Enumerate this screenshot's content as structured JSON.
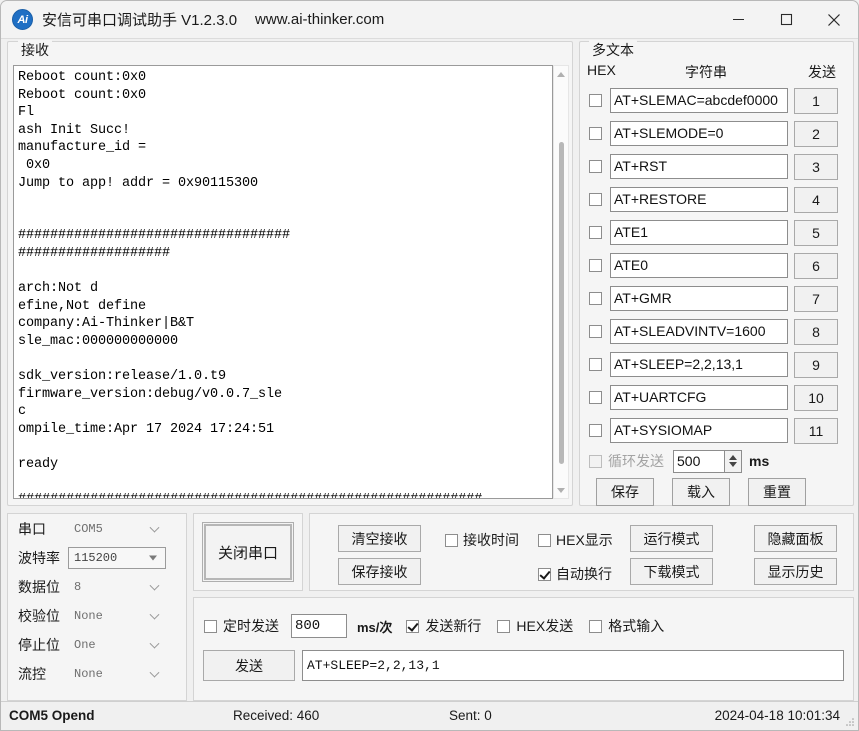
{
  "window": {
    "logo_text": "Ai",
    "title": "安信可串口调试助手 V1.2.3.0",
    "url": "www.ai-thinker.com",
    "minimize_icon": "minimize-icon",
    "maximize_icon": "maximize-icon",
    "close_icon": "close-icon"
  },
  "receive": {
    "legend": "接收",
    "content": "Reboot count:0x0\nReboot count:0x0\nFl\nash Init Succ!\nmanufacture_id =\n 0x0\nJump to app! addr = 0x90115300\n\n\n##################################\n###################\n\narch:Not d\nefine,Not define\ncompany:Ai-Thinker|B&T\nsle_mac:000000000000\n\nsdk_version:release/1.0.t9\nfirmware_version:debug/v0.0.7_sle\nc\nompile_time:Apr 17 2024 17:24:51\n\nready\n\n##########################################################"
  },
  "multitext": {
    "legend": "多文本",
    "col_hex": "HEX",
    "col_string": "字符串",
    "col_send": "发送",
    "rows": [
      {
        "hex_checked": false,
        "command": "AT+SLEMAC=abcdef0000",
        "index": "1"
      },
      {
        "hex_checked": false,
        "command": "AT+SLEMODE=0",
        "index": "2"
      },
      {
        "hex_checked": false,
        "command": "AT+RST",
        "index": "3"
      },
      {
        "hex_checked": false,
        "command": "AT+RESTORE",
        "index": "4"
      },
      {
        "hex_checked": false,
        "command": "ATE1",
        "index": "5"
      },
      {
        "hex_checked": false,
        "command": "ATE0",
        "index": "6"
      },
      {
        "hex_checked": false,
        "command": "AT+GMR",
        "index": "7"
      },
      {
        "hex_checked": false,
        "command": "AT+SLEADVINTV=1600",
        "index": "8"
      },
      {
        "hex_checked": false,
        "command": "AT+SLEEP=2,2,13,1",
        "index": "9"
      },
      {
        "hex_checked": false,
        "command": "AT+UARTCFG",
        "index": "10"
      },
      {
        "hex_checked": false,
        "command": "AT+SYSIOMAP",
        "index": "11"
      }
    ],
    "loop_send_label": "循环发送",
    "loop_send_checked": false,
    "loop_interval": "500",
    "loop_unit": "ms",
    "save_label": "保存",
    "load_label": "载入",
    "reset_label": "重置"
  },
  "settings": {
    "rows": [
      {
        "label": "串口",
        "value": "COM5",
        "active": false
      },
      {
        "label": "波特率",
        "value": "115200",
        "active": true
      },
      {
        "label": "数据位",
        "value": "8",
        "active": false
      },
      {
        "label": "校验位",
        "value": "None",
        "active": false
      },
      {
        "label": "停止位",
        "value": "One",
        "active": false
      },
      {
        "label": "流控",
        "value": "None",
        "active": false
      }
    ]
  },
  "port": {
    "toggle_label": "关闭串口"
  },
  "toolbar": {
    "clear_receive": "清空接收",
    "save_receive": "保存接收",
    "recv_time_label": "接收时间",
    "recv_time_checked": false,
    "hex_display_label": "HEX显示",
    "hex_display_checked": false,
    "auto_wrap_label": "自动换行",
    "auto_wrap_checked": true,
    "run_mode": "运行模式",
    "download_mode": "下载模式",
    "hide_panel": "隐藏面板",
    "show_history": "显示历史"
  },
  "send": {
    "timed_send_label": "定时发送",
    "timed_send_checked": false,
    "timer_value": "800",
    "timer_unit": "ms/次",
    "send_newline_label": "发送新行",
    "send_newline_checked": true,
    "hex_send_label": "HEX发送",
    "hex_send_checked": false,
    "format_input_label": "格式输入",
    "format_input_checked": false,
    "send_button": "发送",
    "send_value": "AT+SLEEP=2,2,13,1"
  },
  "status": {
    "port_state": "COM5 Opend",
    "received": "Received: 460",
    "sent": "Sent: 0",
    "datetime": "2024-04-18 10:01:34"
  }
}
